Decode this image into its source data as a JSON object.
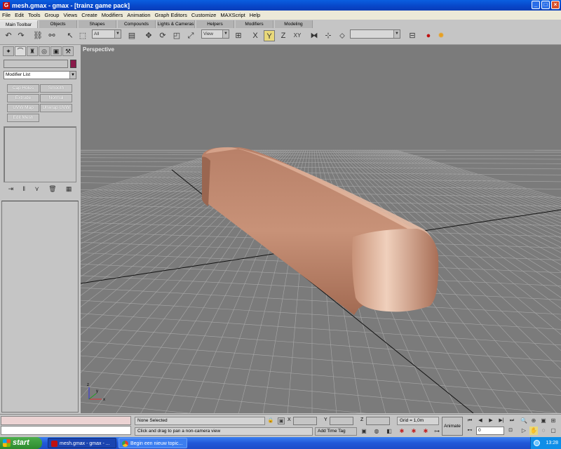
{
  "window": {
    "title": "mesh.gmax - gmax - [trainz game pack]"
  },
  "menubar": {
    "items": [
      "File",
      "Edit",
      "Tools",
      "Group",
      "Views",
      "Create",
      "Modifiers",
      "Animation",
      "Graph Editors",
      "Customize",
      "MAXScript",
      "Help"
    ]
  },
  "tabs": [
    "Main Toolbar",
    "Objects",
    "Shapes",
    "Compounds",
    "Lights & Cameras",
    "Helpers",
    "Modifiers",
    "Modeling"
  ],
  "toolbar": {
    "selection_filter": "All",
    "reference_coord": "View",
    "named_selection": ""
  },
  "command_panel": {
    "modifier_list_label": "Modifier List",
    "modifier_buttons": [
      "Cap Holes",
      "Smooth",
      "Extrude",
      "Normal",
      "UVW Map",
      "Unwrap UVW",
      "Edit Mesh"
    ]
  },
  "viewport": {
    "label": "Perspective",
    "object_color": "#c89278",
    "background": "#7b7b7b"
  },
  "status": {
    "selection": "None Selected",
    "prompt": "Click and drag to pan a non-camera view",
    "x_label": "X",
    "y_label": "Y",
    "z_label": "Z",
    "grid": "Grid = 1,0m",
    "add_time_tag": "Add Time Tag",
    "animate": "Animate",
    "frame": "0"
  },
  "taskbar": {
    "start_label": "start",
    "tasks": [
      "mesh.gmax - gmax - ...",
      "Begin een nieuw topic..."
    ],
    "clock": "13:28"
  }
}
